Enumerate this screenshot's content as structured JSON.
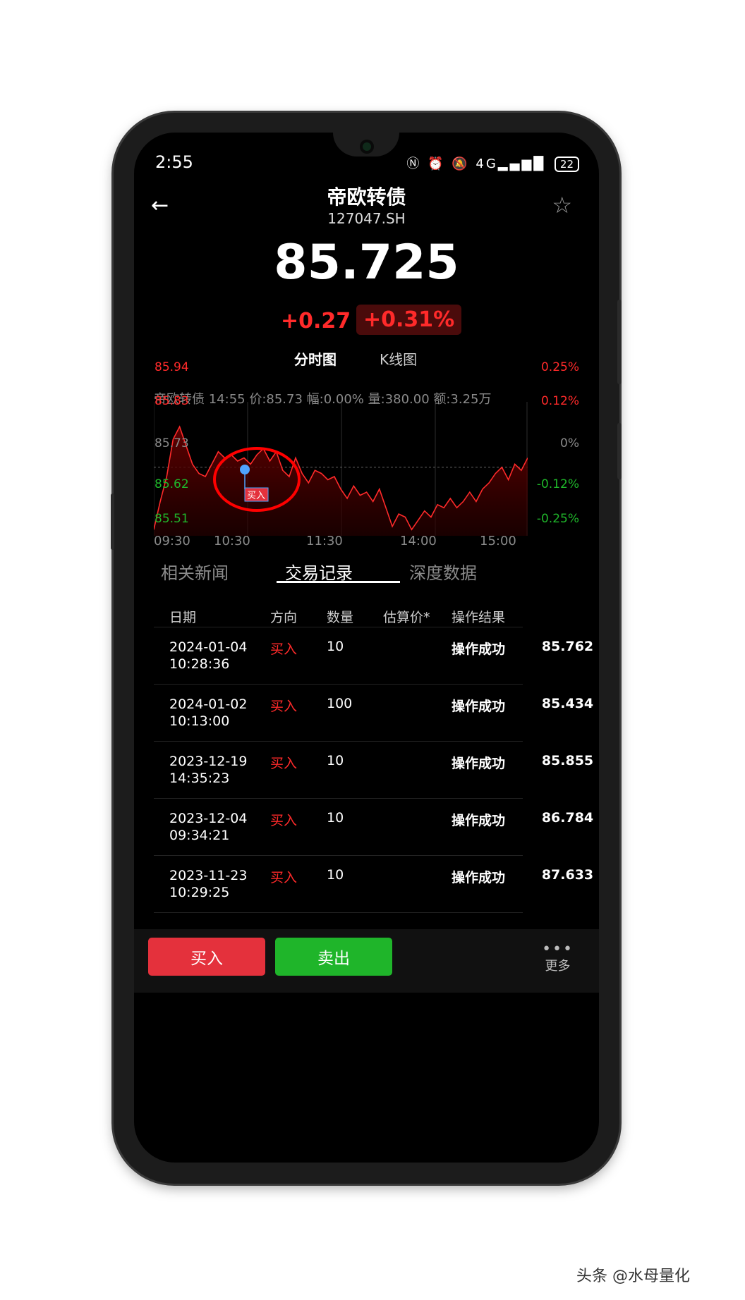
{
  "status_bar": {
    "time": "2:55",
    "icons": [
      "nfc-icon",
      "alarm-icon",
      "mute-icon",
      "4g-signal-icon"
    ],
    "signal_label": "4G",
    "battery": "22"
  },
  "header": {
    "title": "帝欧转债",
    "code": "127047.SH"
  },
  "quote": {
    "price": "85.725",
    "change": "+0.27",
    "change_pct": "+0.31%"
  },
  "chart_tabs": {
    "timeshare": "分时图",
    "kline": "K线图"
  },
  "chart_info": "帝欧转债 14:55 价:85.73 幅:0.00% 量:380.00 额:3.25万",
  "chart_data": {
    "type": "area",
    "title": "",
    "x_ticks": [
      "09:30",
      "10:30",
      "11:30",
      "14:00",
      "15:00"
    ],
    "y_left_ticks": [
      "85.94",
      "85.83",
      "85.73",
      "85.62",
      "85.51"
    ],
    "y_right_ticks": [
      "0.25%",
      "0.12%",
      "0%",
      "-0.12%",
      "-0.25%"
    ],
    "ylim": [
      85.51,
      85.94
    ],
    "reference_price": 85.73,
    "marker_label": "买入",
    "values": [
      85.53,
      85.62,
      85.7,
      85.82,
      85.86,
      85.8,
      85.74,
      85.71,
      85.7,
      85.74,
      85.78,
      85.76,
      85.77,
      85.75,
      85.76,
      85.74,
      85.77,
      85.79,
      85.75,
      85.78,
      85.72,
      85.7,
      85.76,
      85.71,
      85.68,
      85.72,
      85.71,
      85.69,
      85.7,
      85.66,
      85.63,
      85.67,
      85.64,
      85.65,
      85.62,
      85.66,
      85.6,
      85.54,
      85.58,
      85.57,
      85.53,
      85.56,
      85.59,
      85.57,
      85.61,
      85.6,
      85.63,
      85.6,
      85.62,
      85.65,
      85.62,
      85.66,
      85.68,
      85.71,
      85.73,
      85.69,
      85.74,
      85.72,
      85.76
    ]
  },
  "sub_tabs": [
    "相关新闻",
    "交易记录",
    "深度数据"
  ],
  "table": {
    "headers": [
      "日期",
      "方向",
      "数量",
      "估算价*",
      "操作结果"
    ],
    "rows": [
      {
        "date": "2024-01-04",
        "time": "10:28:36",
        "dir": "买入",
        "qty": "10",
        "price": "85.762",
        "result": "操作成功"
      },
      {
        "date": "2024-01-02",
        "time": "10:13:00",
        "dir": "买入",
        "qty": "100",
        "price": "85.434",
        "result": "操作成功"
      },
      {
        "date": "2023-12-19",
        "time": "14:35:23",
        "dir": "买入",
        "qty": "10",
        "price": "85.855",
        "result": "操作成功"
      },
      {
        "date": "2023-12-04",
        "time": "09:34:21",
        "dir": "买入",
        "qty": "10",
        "price": "86.784",
        "result": "操作成功"
      },
      {
        "date": "2023-11-23",
        "time": "10:29:25",
        "dir": "买入",
        "qty": "10",
        "price": "87.633",
        "result": "操作成功"
      }
    ]
  },
  "actions": {
    "buy": "买入",
    "sell": "卖出",
    "more": "更多"
  },
  "watermark": "头条 @水母量化",
  "colors": {
    "up": "#ff2a2a",
    "down": "#1fb52a",
    "buy_button": "#e4313c",
    "sell_button": "#1fb52a",
    "marker": "#4fa3ff"
  }
}
